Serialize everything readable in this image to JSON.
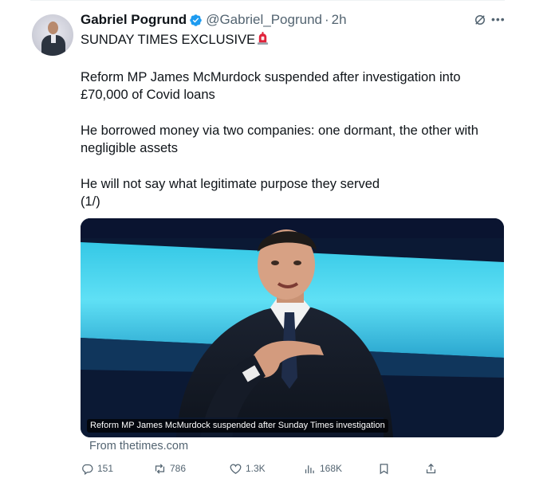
{
  "author": {
    "name": "Gabriel Pogrund",
    "handle": "@Gabriel_Pogrund",
    "separator": "·",
    "time": "2h"
  },
  "tweet": {
    "line1": "SUNDAY TIMES EXCLUSIVE",
    "line2": "Reform MP James McMurdock suspended after investigation into",
    "line3": "£70,000 of Covid loans",
    "line4": "He borrowed money via two companies: one dormant, the other with",
    "line5": "negligible assets",
    "line6": "He will not say what legitimate purpose they served",
    "line7": "(1/)"
  },
  "media": {
    "caption": "Reform MP James McMurdock suspended after Sunday Times investigation"
  },
  "card": {
    "source": "From thetimes.com"
  },
  "actions": {
    "replies": "151",
    "reposts": "786",
    "likes": "1.3K",
    "views": "168K"
  },
  "icons": {
    "verified": "verified-badge-icon",
    "siren": "police-light-emoji",
    "grok": "grok-icon",
    "more": "more-options-icon",
    "reply": "reply-icon",
    "repost": "repost-icon",
    "like": "heart-icon",
    "views": "views-icon",
    "bookmark": "bookmark-icon",
    "share": "share-icon"
  },
  "colors": {
    "text": "#0f1419",
    "secondary": "#536471",
    "verified": "#1d9bf0"
  }
}
